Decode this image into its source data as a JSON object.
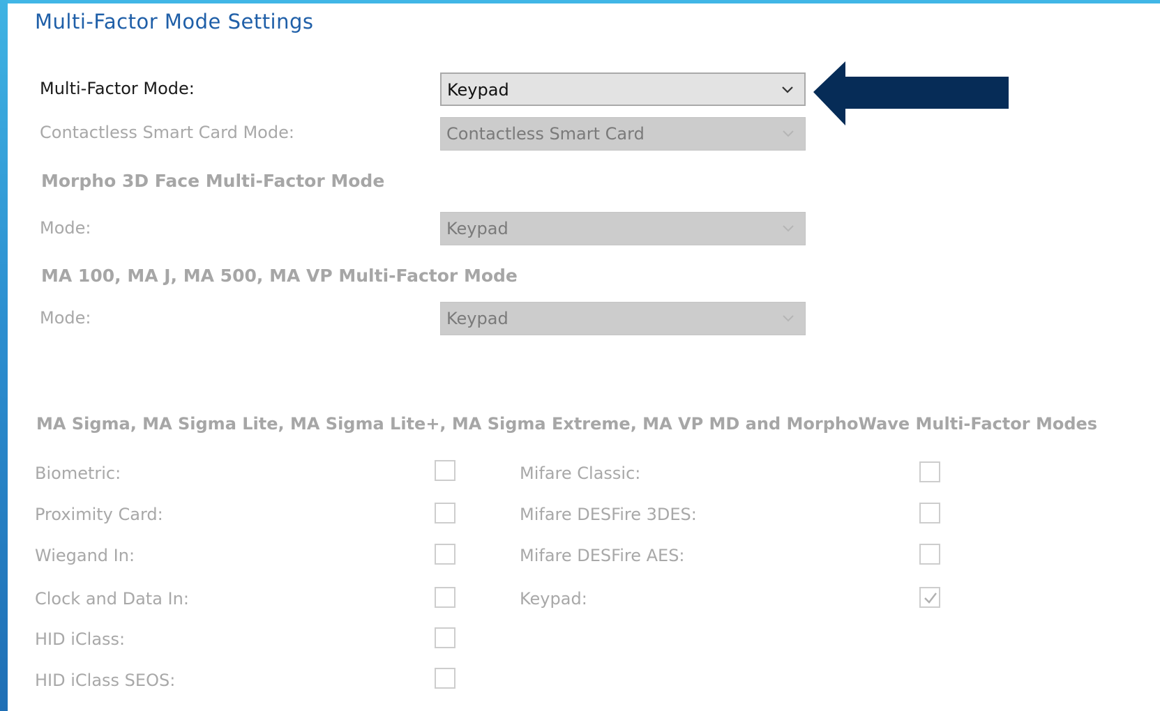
{
  "page": {
    "title": "Multi-Factor Mode Settings"
  },
  "settings": {
    "multi_factor_mode": {
      "label": "Multi-Factor Mode:",
      "value": "Keypad"
    },
    "contactless_mode": {
      "label": "Contactless Smart Card Mode:",
      "value": "Contactless Smart Card"
    }
  },
  "morpho_section": {
    "heading": "Morpho 3D Face Multi-Factor Mode",
    "mode_label": "Mode:",
    "mode_value": "Keypad"
  },
  "ma_section": {
    "heading": "MA 100, MA J, MA 500, MA VP Multi-Factor Mode",
    "mode_label": "Mode:",
    "mode_value": "Keypad"
  },
  "sigma_section": {
    "heading": "MA Sigma, MA Sigma Lite, MA Sigma Lite+, MA Sigma Extreme, MA VP MD and MorphoWave Multi-Factor Modes",
    "left_options": [
      {
        "label": "Biometric:",
        "checked": false
      },
      {
        "label": "Proximity Card:",
        "checked": false
      },
      {
        "label": "Wiegand In:",
        "checked": false
      },
      {
        "label": "Clock and Data In:",
        "checked": false
      },
      {
        "label": "HID iClass:",
        "checked": false
      },
      {
        "label": "HID iClass SEOS:",
        "checked": false
      }
    ],
    "right_options": [
      {
        "label": "Mifare Classic:",
        "checked": false
      },
      {
        "label": "Mifare DESFire 3DES:",
        "checked": false
      },
      {
        "label": "Mifare DESFire AES:",
        "checked": false
      },
      {
        "label": "Keypad:",
        "checked": true
      }
    ]
  },
  "icons": {
    "dropdown": "chevron-down-icon",
    "pointer": "arrow-left-icon",
    "check": "checkmark-icon"
  },
  "colors": {
    "title": "#1f5fa8",
    "accent_bar": "#41b6e6",
    "arrow": "#062c57",
    "disabled_text": "#a8a8a8"
  }
}
